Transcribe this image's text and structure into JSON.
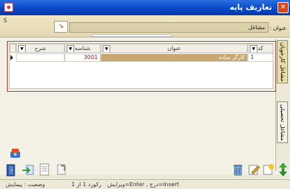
{
  "window": {
    "title": "تعاريف پايه",
    "close_glyph": "✕"
  },
  "form": {
    "s_label": "S",
    "title_label": "عنوان :",
    "title_value": "مشاغل",
    "arrow_glyph": "↘"
  },
  "tabs": [
    {
      "label": "مشاغل كارجويان"
    },
    {
      "label": "مشاغل تحصيلی"
    }
  ],
  "grid": {
    "columns": [
      {
        "key": "code",
        "label": "كد"
      },
      {
        "key": "title",
        "label": "عنوان"
      },
      {
        "key": "id",
        "label": "شناسه"
      },
      {
        "key": "desc",
        "label": "شرح"
      }
    ],
    "dropdown_glyph": "▼",
    "rows": [
      {
        "code": "1",
        "title": "كارگر ساده",
        "id": "3001",
        "desc": ""
      }
    ]
  },
  "status": {
    "hint": "Insert=درج , Enter=ويرايش",
    "record": "ركورد 1 از 1",
    "state": "وضعيت : پيمايش"
  },
  "colors": {
    "titlebar": "#0a48c8",
    "highlight": "#e02020",
    "selected_row": "#c8a870",
    "topband": "#e3d8b2"
  }
}
